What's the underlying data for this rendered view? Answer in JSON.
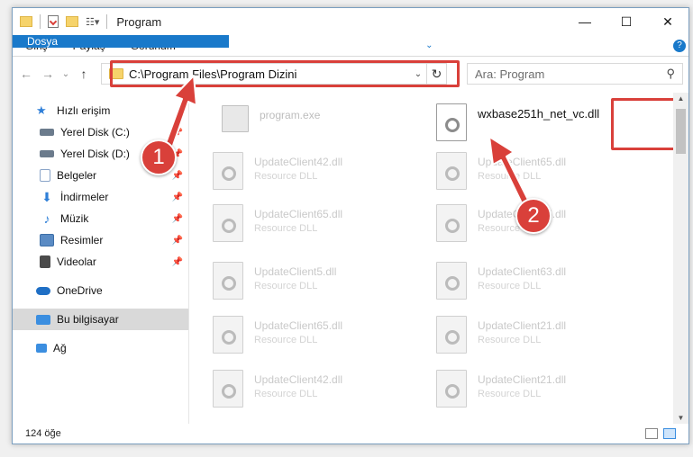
{
  "window": {
    "title": "Program"
  },
  "window_buttons": {
    "minimize": "—",
    "maximize": "☐",
    "close": "✕"
  },
  "ribbon": {
    "tabs": [
      "Dosya",
      "Giriş",
      "Paylaş",
      "Görünüm"
    ]
  },
  "address": {
    "path": "C:\\Program Files\\Program Dizini"
  },
  "search": {
    "placeholder": "Ara: Program"
  },
  "sidebar": {
    "items": [
      {
        "label": "Hızlı erişim",
        "icon": "star-icon",
        "color": "#2f7fd8",
        "pinned": false
      },
      {
        "label": "Yerel Disk (C:)",
        "icon": "drive-icon",
        "color": "#6b7b8c",
        "pinned": true
      },
      {
        "label": "Yerel Disk (D:)",
        "icon": "drive-icon",
        "color": "#6b7b8c",
        "pinned": true
      },
      {
        "label": "Belgeler",
        "icon": "document-icon",
        "color": "#8aa4c8",
        "pinned": true
      },
      {
        "label": "İndirmeler",
        "icon": "download-icon",
        "color": "#2f7fd8",
        "pinned": true
      },
      {
        "label": "Müzik",
        "icon": "music-icon",
        "color": "#2f7fd8",
        "pinned": true
      },
      {
        "label": "Resimler",
        "icon": "pictures-icon",
        "color": "#5a8bc4",
        "pinned": true
      },
      {
        "label": "Videolar",
        "icon": "video-icon",
        "color": "#4b4b4b",
        "pinned": true
      },
      {
        "label": "OneDrive",
        "icon": "cloud-icon",
        "color": "#1f6fc5",
        "pinned": false
      },
      {
        "label": "Bu bilgisayar",
        "icon": "computer-icon",
        "color": "#3b8ee0",
        "pinned": false
      },
      {
        "label": "Ağ",
        "icon": "network-icon",
        "color": "#3b8ee0",
        "pinned": false
      }
    ]
  },
  "files": {
    "exe": {
      "name": "program.exe"
    },
    "main": {
      "name": "wxbase251h_net_vc.dll"
    },
    "faded": [
      {
        "name": "UpdateClient42.dll",
        "type": "Resource DLL"
      },
      {
        "name": "UpdateClient65.dll",
        "type": "Resource DLL"
      },
      {
        "name": "UpdateClient65.dll",
        "type": "Resource DLL"
      },
      {
        "name": "UpdateClient65.dll",
        "type": "Resource DLL"
      },
      {
        "name": "UpdateClient5.dll",
        "type": "Resource DLL"
      },
      {
        "name": "UpdateClient63.dll",
        "type": "Resource DLL"
      },
      {
        "name": "UpdateClient65.dll",
        "type": "Resource DLL"
      },
      {
        "name": "UpdateClient21.dll",
        "type": "Resource DLL"
      },
      {
        "name": "UpdateClient42.dll",
        "type": "Resource DLL"
      },
      {
        "name": "UpdateClient21.dll",
        "type": "Resource DLL"
      }
    ]
  },
  "annotations": {
    "badge1": "1",
    "badge2": "2",
    "color": "#d9403a"
  },
  "status": {
    "count": "124 öğe"
  }
}
